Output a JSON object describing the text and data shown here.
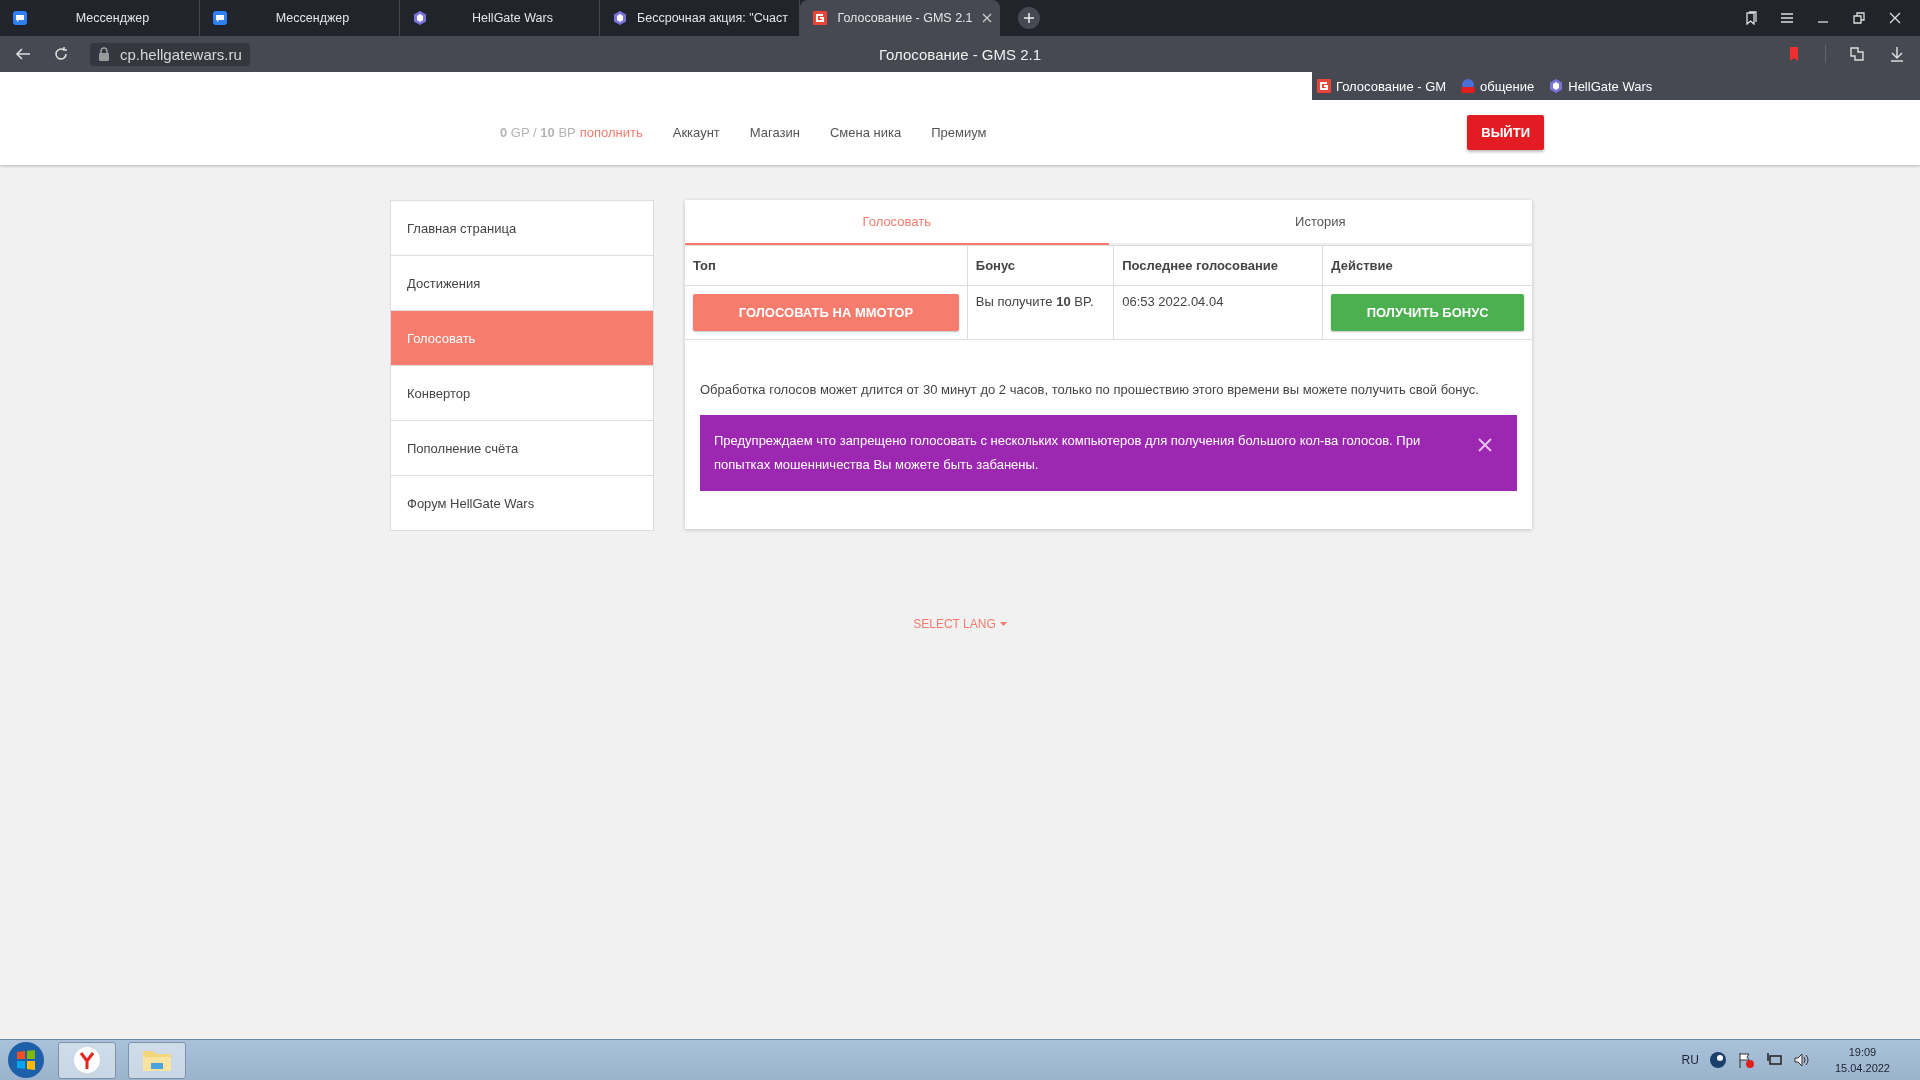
{
  "browser": {
    "tabs": [
      {
        "title": "Мессенджер",
        "kind": "messenger",
        "selected": false
      },
      {
        "title": "Мессенджер",
        "kind": "messenger",
        "selected": false
      },
      {
        "title": "HellGate Wars",
        "kind": "hellgate",
        "selected": false
      },
      {
        "title": "Бессрочная акция: \"Счаст",
        "kind": "hellgate",
        "selected": false
      },
      {
        "title": "Голосование - GMS 2.1",
        "kind": "gms",
        "selected": true
      }
    ],
    "address": "cp.hellgatewars.ru",
    "page_title": "Голосование - GMS 2.1",
    "bookmarks": [
      {
        "label": "Голосование - GM",
        "kind": "gms"
      },
      {
        "label": "общение",
        "kind": "chat"
      },
      {
        "label": "HellGate Wars",
        "kind": "hellgate"
      }
    ]
  },
  "header": {
    "balance": {
      "gp": "0",
      "gp_unit": "GP",
      "separator": "/",
      "bp": "10",
      "bp_unit": "BP",
      "topup": "пополнить"
    },
    "nav": [
      "Аккаунт",
      "Магазин",
      "Смена ника",
      "Премиум"
    ],
    "logout": "ВЫЙТИ"
  },
  "sidebar": {
    "items": [
      {
        "label": "Главная страница",
        "selected": false
      },
      {
        "label": "Достижения",
        "selected": false
      },
      {
        "label": "Голосовать",
        "selected": true
      },
      {
        "label": "Конвертор",
        "selected": false
      },
      {
        "label": "Пополнение счёта",
        "selected": false
      },
      {
        "label": "Форум HellGate Wars",
        "selected": false
      }
    ]
  },
  "panel": {
    "tabs": [
      {
        "label": "Голосовать",
        "selected": true
      },
      {
        "label": "История",
        "selected": false
      }
    ],
    "table": {
      "columns": [
        "Топ",
        "Бонус",
        "Последнее голосование",
        "Действие"
      ],
      "rows": [
        {
          "vote_button": "ГОЛОСОВАТЬ НА ММОТОР",
          "bonus": "Вы получите **10** BP.",
          "last_vote": "06:53 2022.04.04",
          "action_button": "ПОЛУЧИТЬ БОНУС"
        }
      ]
    },
    "info": "Обработка голосов может длится от 30 минут до 2 часов, только по прошествию этого времени вы можете получить свой бонус.",
    "alert": "Предупреждаем что запрещено голосовать с нескольких компьютеров для получения большого кол-ва голосов. При попытках мошенничества Вы можете быть забанены."
  },
  "footer": {
    "select_lang": "SELECT LANG"
  },
  "taskbar": {
    "language": "RU",
    "time": "19:09",
    "date": "15.04.2022"
  }
}
